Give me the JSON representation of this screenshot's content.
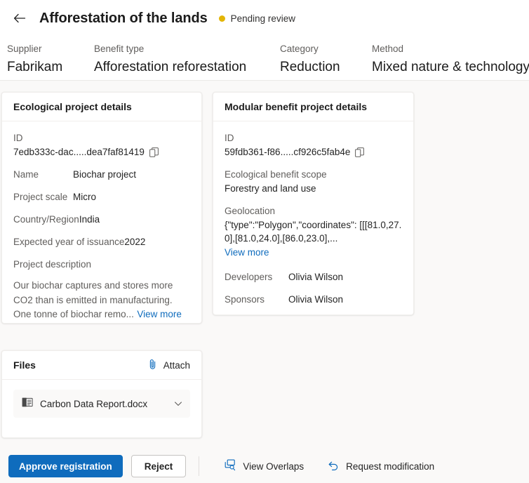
{
  "header": {
    "back_icon": "arrow-left-icon",
    "title": "Afforestation of the lands",
    "status": {
      "label": "Pending review",
      "dot_color": "#e3b505"
    },
    "meta": [
      {
        "label": "Supplier",
        "value": "Fabrikam"
      },
      {
        "label": "Benefit type",
        "value": "Afforestation reforestation"
      },
      {
        "label": "Category",
        "value": "Reduction"
      },
      {
        "label": "Method",
        "value": "Mixed nature & technology"
      }
    ]
  },
  "ecological_card": {
    "title": "Ecological project details",
    "id_label": "ID",
    "id_value": "7edb333c-dac.....dea7faf81419",
    "copy_icon": "copy-icon",
    "name_label": "Name",
    "name_value": "Biochar project",
    "scale_label": "Project scale",
    "scale_value": "Micro",
    "country_label": "Country/Region",
    "country_value": "India",
    "issuance_label": "Expected year of issuance",
    "issuance_value": "2022",
    "description_label": "Project description",
    "description_value": "Our biochar captures and stores more CO2 than is emitted in manufacturing. One tonne of biochar remo...",
    "view_more": "View more"
  },
  "modular_card": {
    "title": "Modular benefit project details",
    "id_label": "ID",
    "id_value": "59fdb361-f86.....cf926c5fab4e",
    "copy_icon": "copy-icon",
    "scope_label": "Ecological benefit scope",
    "scope_value": "Forestry and land use",
    "geolocation_label": "Geolocation",
    "geolocation_value": "{\"type\":\"Polygon\",\"coordinates\": [[[81.0,27.0],[81.0,24.0],[86.0,23.0],...",
    "view_more": "View more",
    "developers_label": "Developers",
    "developers_value": "Olivia Wilson",
    "sponsors_label": "Sponsors",
    "sponsors_value": "Olivia Wilson"
  },
  "files_card": {
    "title": "Files",
    "attach_label": "Attach",
    "attach_icon": "paperclip-icon",
    "files": [
      {
        "name": "Carbon Data Report.docx",
        "icon": "word-document-icon",
        "chevron": "chevron-down-icon"
      }
    ]
  },
  "footer": {
    "approve_label": "Approve registration",
    "reject_label": "Reject",
    "view_overlaps_label": "View Overlaps",
    "view_overlaps_icon": "overlap-search-icon",
    "request_modification_label": "Request modification",
    "request_modification_icon": "undo-arrow-icon"
  },
  "colors": {
    "accent": "#0f6cbd",
    "page_bg": "#faf9f8",
    "card_bg": "#ffffff",
    "status": "#e3b505",
    "label_text": "#605e5c",
    "value_text": "#242424"
  }
}
